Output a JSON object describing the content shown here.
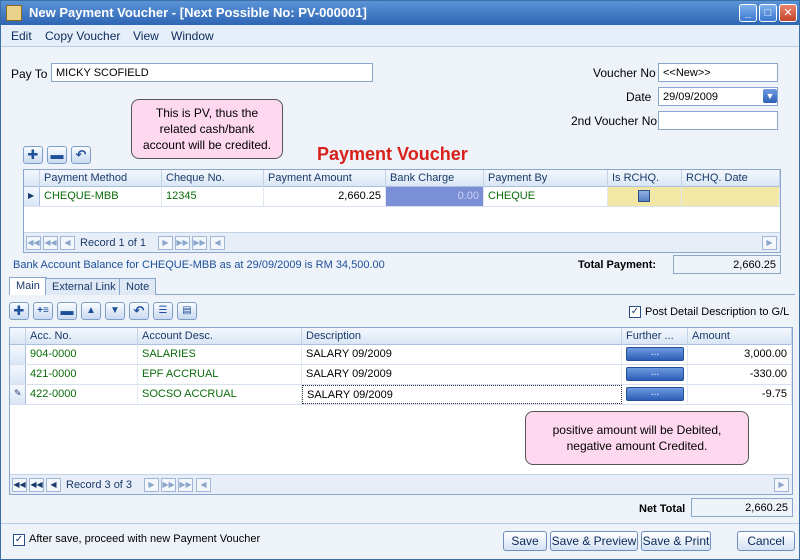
{
  "window": {
    "title": "New Payment Voucher - [Next Possible No: PV-000001]",
    "min": "_",
    "max": "□",
    "close": "✕"
  },
  "menu": [
    "Edit",
    "Copy Voucher",
    "View",
    "Window"
  ],
  "form": {
    "pay_to_label": "Pay To",
    "pay_to_value": "MICKY SCOFIELD",
    "voucher_no_label": "Voucher No",
    "voucher_no_value": "<<New>>",
    "date_label": "Date",
    "date_value": "29/09/2009",
    "second_voucher_label": "2nd Voucher No",
    "second_voucher_value": ""
  },
  "callouts": {
    "pv": "This is PV, thus the related cash/bank account will be credited.",
    "amount": "positive amount will be Debited, negative amount Credited."
  },
  "heading": "Payment Voucher",
  "payment_grid": {
    "columns": [
      "Payment Method",
      "Cheque No.",
      "Payment Amount",
      "Bank Charge",
      "Payment By",
      "Is RCHQ.",
      "RCHQ. Date"
    ],
    "rows": [
      {
        "method": "CHEQUE-MBB",
        "cheque_no": "12345",
        "amount": "2,660.25",
        "bank_charge": "0.00",
        "payment_by": "CHEQUE",
        "rchq_date": ""
      }
    ],
    "record_text": "Record 1 of 1"
  },
  "balance_text": "Bank Account Balance for CHEQUE-MBB as at 29/09/2009 is RM 34,500.00",
  "total_payment_label": "Total Payment:",
  "total_payment_value": "2,660.25",
  "tabs": [
    "Main",
    "External Link",
    "Note"
  ],
  "post_detail_label": "Post Detail Description to G/L",
  "detail_grid": {
    "columns": [
      "Acc. No.",
      "Account Desc.",
      "Description",
      "Further ...",
      "Amount"
    ],
    "rows": [
      {
        "acc": "904-0000",
        "desc": "SALARIES",
        "description": "SALARY 09/2009",
        "amount": "3,000.00"
      },
      {
        "acc": "421-0000",
        "desc": "EPF ACCRUAL",
        "description": "SALARY 09/2009",
        "amount": "-330.00"
      },
      {
        "acc": "422-0000",
        "desc": "SOCSO ACCRUAL",
        "description": "SALARY 09/2009",
        "amount": "-9.75"
      }
    ],
    "further_button": "...",
    "record_text": "Record 3 of 3"
  },
  "net_total_label": "Net Total",
  "net_total_value": "2,660.25",
  "after_save_label": "After save, proceed with new Payment Voucher",
  "buttons": {
    "save": "Save",
    "save_preview": "Save & Preview",
    "save_print": "Save & Print",
    "cancel": "Cancel"
  },
  "colors": {
    "heading": "#d8201a",
    "highlight_row": "#f3e7a6",
    "bank_charge_cell": "#7b8fd6",
    "green_text": "#0b6b0b"
  }
}
